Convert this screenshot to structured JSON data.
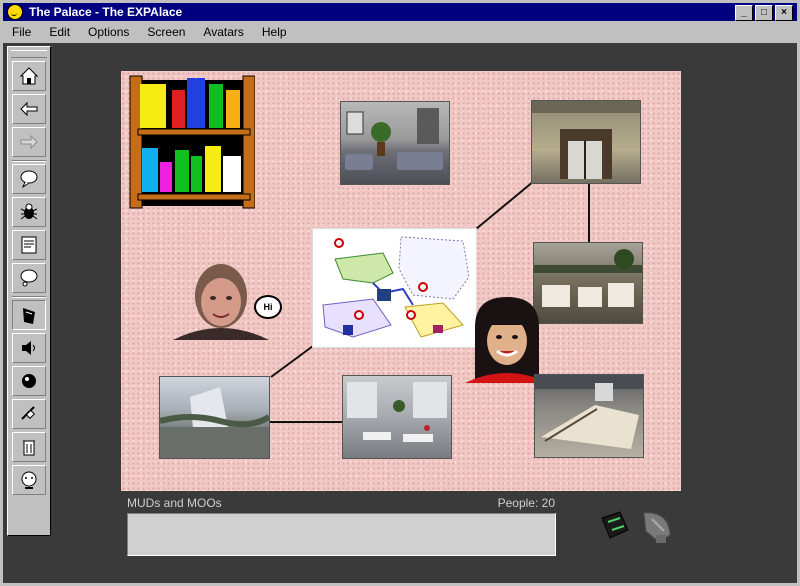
{
  "window": {
    "title": "The Palace - The EXPAlace",
    "controls": {
      "minimize": "_",
      "maximize": "□",
      "close": "×"
    }
  },
  "menu": {
    "items": [
      "File",
      "Edit",
      "Options",
      "Screen",
      "Avatars",
      "Help"
    ]
  },
  "toolbar": {
    "tools": [
      {
        "icon": "home-icon",
        "glyph": "⌂",
        "enabled": true
      },
      {
        "icon": "back-arrow-icon",
        "glyph": "⇐",
        "enabled": true
      },
      {
        "icon": "forward-arrow-icon",
        "glyph": "⇒",
        "enabled": false
      },
      {
        "icon": "speech-balloon-icon",
        "glyph": "💬",
        "enabled": true
      },
      {
        "icon": "bug-icon",
        "glyph": "✱",
        "enabled": true
      },
      {
        "icon": "sign-icon",
        "glyph": "▤",
        "enabled": true
      },
      {
        "icon": "whisper-balloon-icon",
        "glyph": "💭",
        "enabled": true
      },
      {
        "icon": "paint-icon",
        "glyph": "✎",
        "enabled": true
      },
      {
        "icon": "speaker-icon",
        "glyph": "🔊",
        "enabled": true
      },
      {
        "icon": "ball-icon",
        "glyph": "●",
        "enabled": true
      },
      {
        "icon": "satellite-icon",
        "glyph": "⚲",
        "enabled": true
      },
      {
        "icon": "trash-icon",
        "glyph": "▥",
        "enabled": true
      },
      {
        "icon": "face-icon",
        "glyph": "☻",
        "enabled": true
      }
    ]
  },
  "room": {
    "speech_bubble_text": "Hi"
  },
  "status": {
    "room_name": "MUDs and MOOs",
    "people": "People: 20"
  },
  "chat": {
    "input_value": ""
  },
  "bottom_icons": {
    "left": "prop-bag-icon",
    "right": "satellite-dish-icon"
  }
}
